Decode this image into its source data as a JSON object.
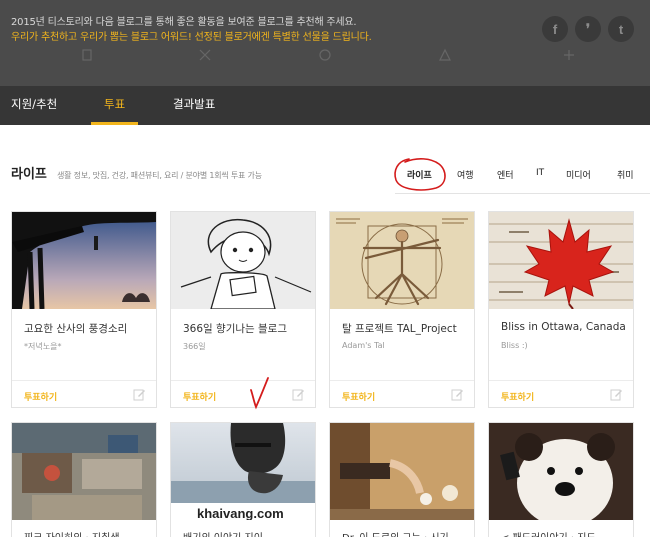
{
  "banner": {
    "line1": "2015년 티스토리와 다음 블로그를 통해 좋은 활동을 보여준 블로그를 추천해 주세요.",
    "line2": "우리가 추천하고 우리가 뽑는 블로그 어워드! 선정된 블로거에겐 특별한 선물을 드립니다.",
    "social": [
      {
        "icon": "facebook-icon",
        "glyph": "f"
      },
      {
        "icon": "kakaostory-icon",
        "glyph": "❜"
      },
      {
        "icon": "twitter-icon",
        "glyph": "t"
      }
    ]
  },
  "nav": {
    "tabs": [
      {
        "label": "지원/추천",
        "active": false
      },
      {
        "label": "투표",
        "active": true
      },
      {
        "label": "결과발표",
        "active": false
      }
    ]
  },
  "section": {
    "title": "라이프",
    "description": "생활 정보, 맛집, 건강, 패션뷰티, 요리 / 분야별 1회씩 투표 가능",
    "categories": [
      {
        "label": "라이프",
        "active": true
      },
      {
        "label": "여행",
        "active": false
      },
      {
        "label": "엔터",
        "active": false
      },
      {
        "label": "IT",
        "active": false
      },
      {
        "label": "미디어",
        "active": false
      },
      {
        "label": "취미",
        "active": false
      }
    ]
  },
  "cards": [
    {
      "title": "고요한 산사의 풍경소리",
      "author": "*저녁노을*",
      "vote_label": "투표하기"
    },
    {
      "title": "366일 향기나는 블로그",
      "author": "366일",
      "vote_label": "투표하기"
    },
    {
      "title": "탈 프로젝트 TAL_Project",
      "author": "Adam's Tal",
      "vote_label": "투표하기"
    },
    {
      "title": "Bliss in Ottawa, Canada",
      "author": "Bliss :)",
      "vote_label": "투표하기"
    }
  ],
  "cards_row2": [
    {
      "title": "찌크 자이히의 · 지취생"
    },
    {
      "title": "배기의 이야기 지이"
    },
    {
      "title": "Dr. 이 도로의 그는 · 시기"
    },
    {
      "title": "< 패드러이야기 · 지드"
    }
  ],
  "thumb_text": {
    "card2_2": "khaivang.com"
  },
  "colors": {
    "accent": "#f2b51c",
    "banner_bg": "#4b4b4b",
    "nav_bg": "#363636",
    "annotation": "#d41c1c"
  }
}
